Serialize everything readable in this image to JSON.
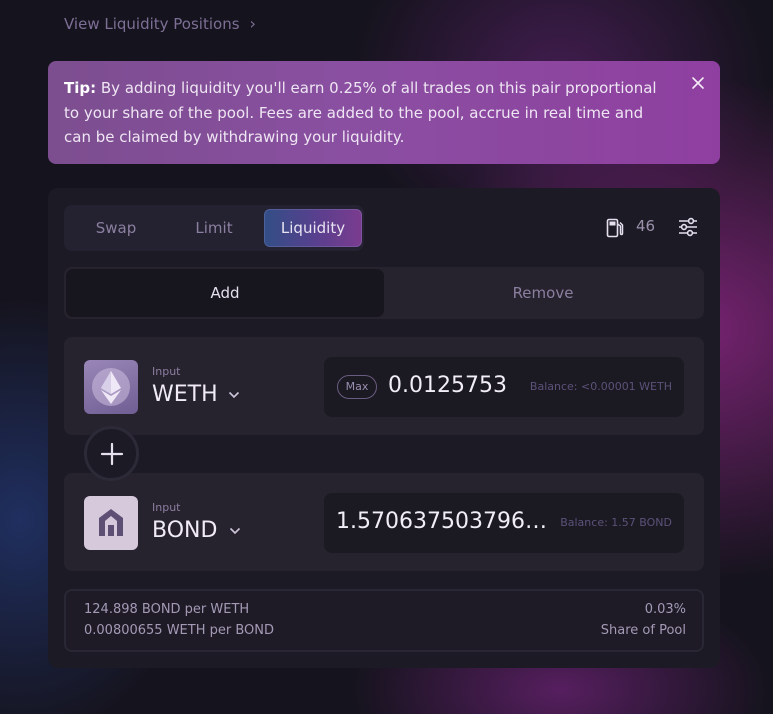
{
  "nav": {
    "view_positions_label": "View Liquidity Positions",
    "chevron": "›"
  },
  "tip": {
    "label": "Tip:",
    "text": " By adding liquidity you'll earn 0.25% of all trades on this pair proportional to your share of the pool. Fees are added to the pool, accrue in real time and can be claimed by withdrawing your liquidity.",
    "close_icon": "close-icon"
  },
  "tabs": [
    {
      "label": "Swap"
    },
    {
      "label": "Limit"
    },
    {
      "label": "Liquidity",
      "active": true
    }
  ],
  "gas": {
    "icon": "gas-pump-icon",
    "value": "46"
  },
  "settings_icon": "sliders-icon",
  "mode": {
    "add_label": "Add",
    "remove_label": "Remove",
    "active": "Add"
  },
  "token_a": {
    "sub_label": "Input",
    "symbol": "WETH",
    "icon": "ethereum-icon",
    "max_label": "Max",
    "amount": "0.0125753",
    "balance": "Balance: <0.00001 WETH"
  },
  "token_b": {
    "sub_label": "Input",
    "symbol": "BOND",
    "icon": "bond-icon",
    "amount": "1.5706375037968...",
    "balance": "Balance: 1.57 BOND"
  },
  "pool": {
    "price_a": "124.898 BOND per WETH",
    "price_b": "0.00800655 WETH per BOND",
    "share_value": "0.03%",
    "share_label": "Share of Pool"
  },
  "colors": {
    "accent_tab_start": "#324e86",
    "accent_tab_end": "#7b3c8f",
    "tip_bg": "#8a4fa1",
    "card_bg": "#1c1a24"
  }
}
